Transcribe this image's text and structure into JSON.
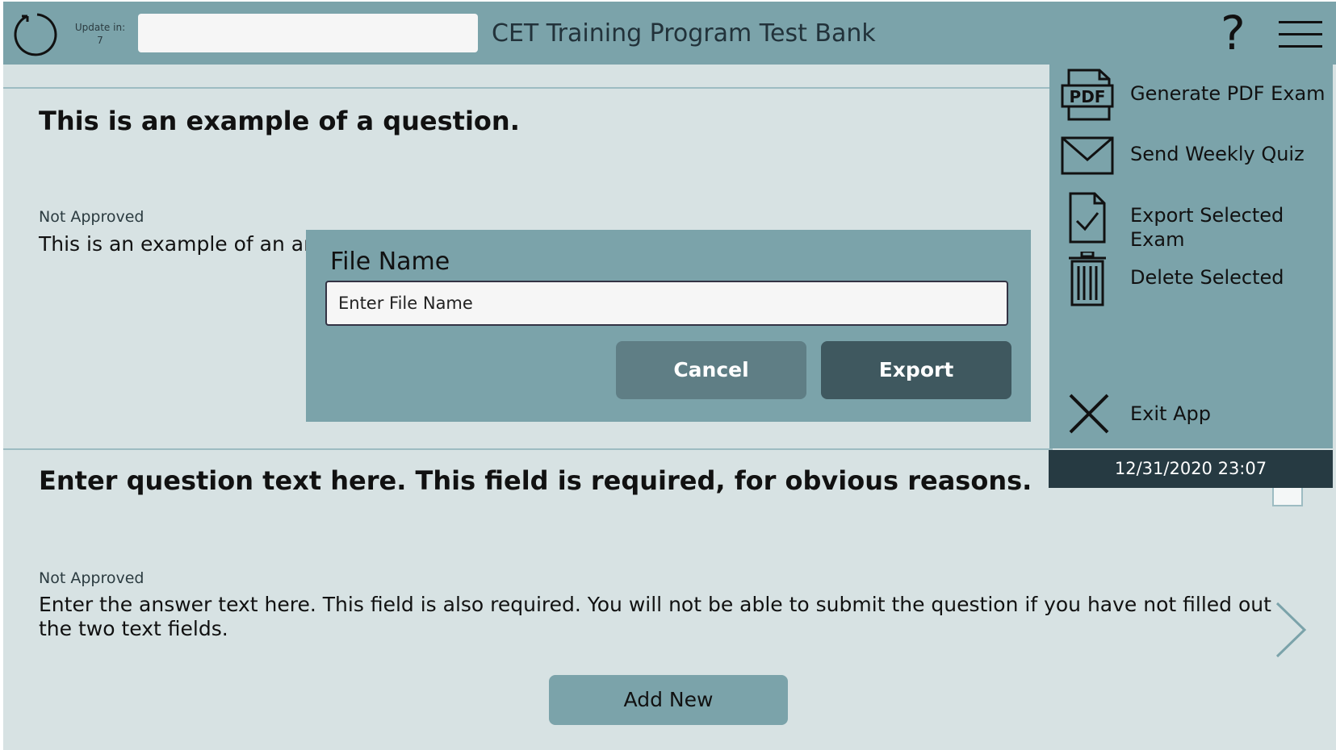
{
  "header": {
    "update_label": "Update in:",
    "update_count": "7",
    "title": "CET Training Program Test Bank",
    "help_label": "?"
  },
  "questions": [
    {
      "question": "This is an example of a question.",
      "status": "Not Approved",
      "answer": "This is an example of an ans"
    },
    {
      "question": "Enter question text here. This field is required, for obvious reasons.",
      "status": "Not Approved",
      "answer": "Enter the answer text here. This field is also required. You will not be able to submit the question if you have not filled out the two text fields."
    }
  ],
  "add_new_label": "Add New",
  "modal": {
    "title": "File Name",
    "placeholder": "Enter File Name",
    "cancel_label": "Cancel",
    "export_label": "Export"
  },
  "menu": {
    "items": [
      {
        "label": "Generate PDF Exam",
        "icon": "pdf-icon"
      },
      {
        "label": "Send Weekly Quiz",
        "icon": "envelope-icon"
      },
      {
        "label": "Export Selected Exam",
        "icon": "document-check-icon"
      },
      {
        "label": "Delete Selected",
        "icon": "trash-icon"
      },
      {
        "label": "Exit App",
        "icon": "close-icon"
      }
    ],
    "pdf_icon_text": "PDF",
    "datetime": "12/31/2020 23:07"
  },
  "colors": {
    "header": "#7ba3aa",
    "background": "#d7e2e3",
    "export_button": "#3f585f",
    "cancel_button": "#5f7e85",
    "datebar": "#263a42"
  }
}
